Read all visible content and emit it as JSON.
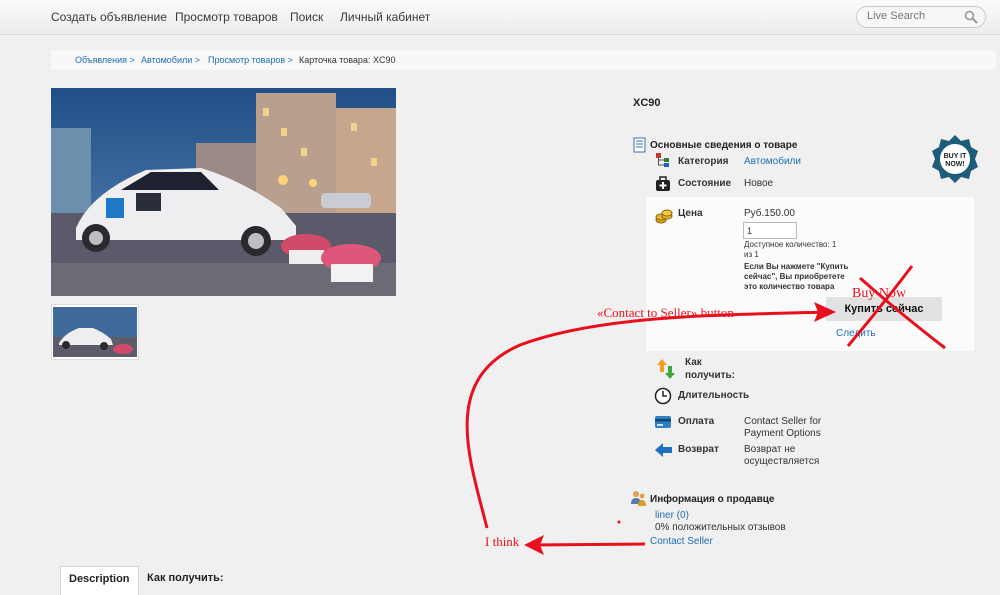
{
  "nav": {
    "items": [
      "Создать объявление",
      "Просмотр товаров",
      "Поиск",
      "Личный кабинет"
    ],
    "search_placeholder": "Live Search"
  },
  "breadcrumb": [
    {
      "label": "Объявления >",
      "link": true
    },
    {
      "label": "Автомобили >",
      "link": true
    },
    {
      "label": "Просмотр товаров >",
      "link": true
    },
    {
      "label": "Карточка товара: XC90",
      "link": false
    }
  ],
  "product": {
    "title": "XC90",
    "basic_info_title": "Основные сведения о товаре",
    "category_label": "Категория",
    "category_value": "Автомобили",
    "condition_label": "Состояние",
    "condition_value": "Новое",
    "price_label": "Цена",
    "price_value": "Руб.150.00",
    "quantity_value": "1",
    "available_line1": "Доступное количество: 1",
    "available_line2": "из 1",
    "buy_note": [
      "Если Вы нажмете \"Купить",
      "сейчас\", Вы приобретете",
      "это количество товара"
    ],
    "buy_button": "Купить сейчас",
    "follow_link": "Следить",
    "badge_text": [
      "BUY IT",
      "NOW!"
    ]
  },
  "delivery": {
    "how_to_get_label": [
      "Как",
      "получить:"
    ],
    "duration_label": "Длительность",
    "payment_label": "Оплата",
    "payment_value": [
      "Contact Seller for",
      "Payment Options"
    ],
    "return_label": "Возврат",
    "return_value": [
      "Возврат не",
      "осуществляется"
    ]
  },
  "seller": {
    "title": "Информация о продавце",
    "name_link": "liner (0)",
    "feedback": "0% положительных отзывов",
    "contact_link": "Contact Seller"
  },
  "tabs": [
    "Description",
    "Как получить:"
  ],
  "annotations": {
    "contact_button_note": "«Contact to Seller» button",
    "buy_now_note": "Buy Now",
    "i_think_note": "I think",
    "color": "#e8101e"
  }
}
